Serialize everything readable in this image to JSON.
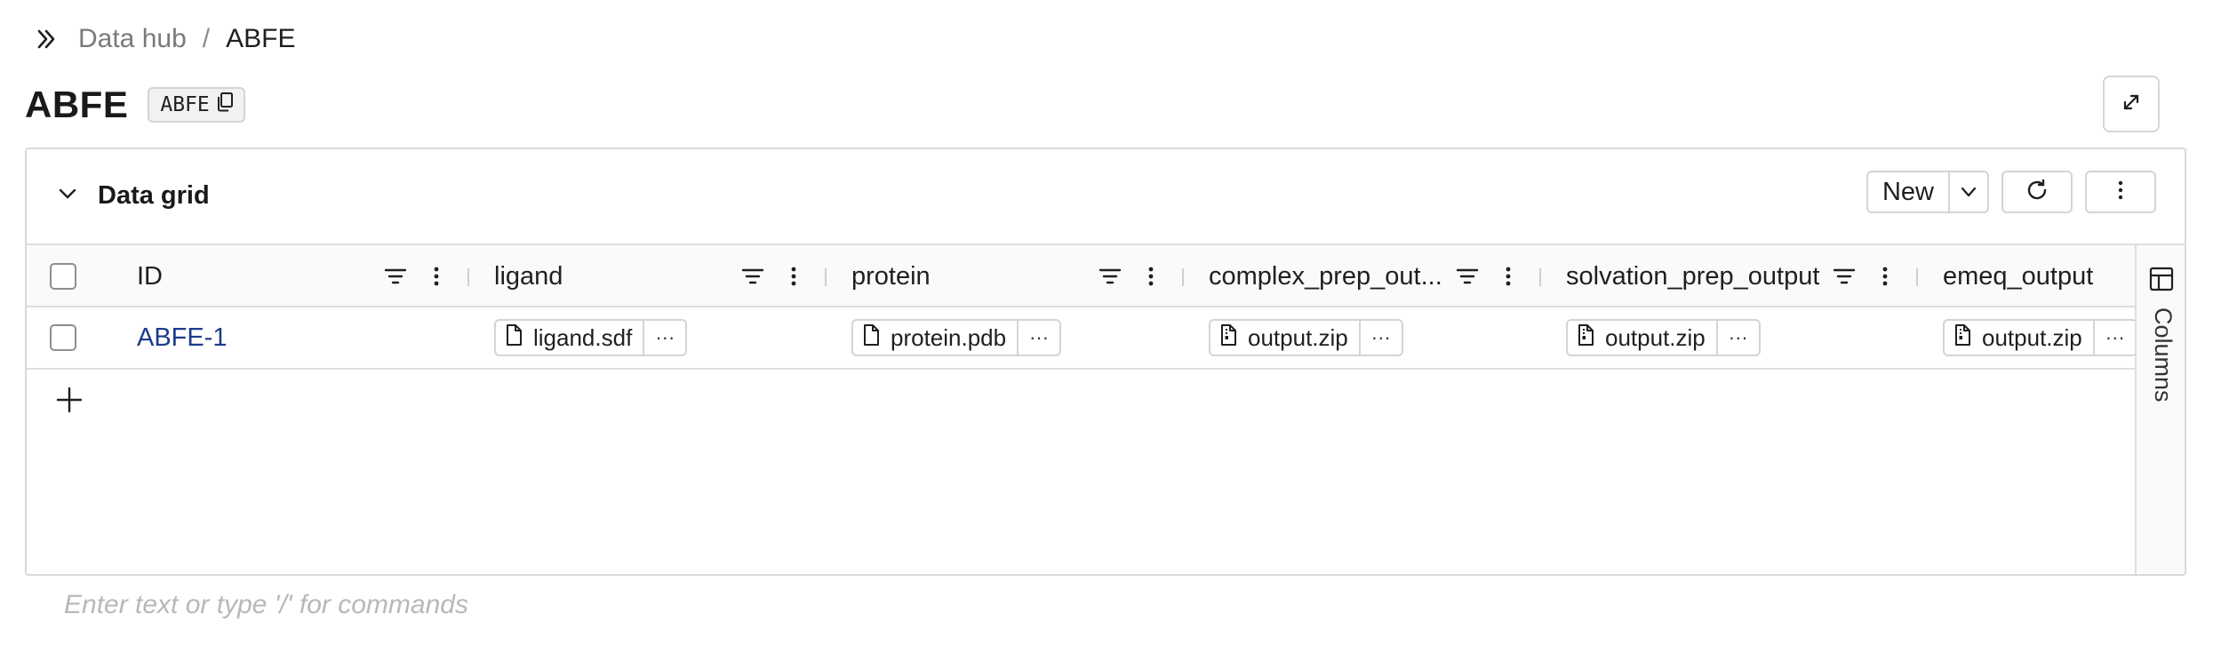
{
  "breadcrumb": {
    "parent": "Data hub",
    "separator": "/",
    "current": "ABFE",
    "toggle_icon": "double-chevron-right-icon"
  },
  "header": {
    "title": "ABFE",
    "tag": "ABFE",
    "tag_icon": "copy-icon",
    "expand_icon": "expand-icon"
  },
  "panel": {
    "title": "Data grid",
    "collapse_icon": "chevron-down-icon",
    "toolbar": {
      "new_label": "New",
      "new_menu_icon": "chevron-down-icon",
      "refresh_icon": "refresh-icon",
      "more_icon": "vertical-dots-icon"
    }
  },
  "grid": {
    "columns": [
      {
        "key": "id",
        "label": "ID"
      },
      {
        "key": "ligand",
        "label": "ligand"
      },
      {
        "key": "protein",
        "label": "protein"
      },
      {
        "key": "complex",
        "label": "complex_prep_out..."
      },
      {
        "key": "solvation",
        "label": "solvation_prep_output"
      },
      {
        "key": "emeq",
        "label": "emeq_output"
      }
    ],
    "rows": [
      {
        "id": "ABFE-1",
        "ligand": {
          "file": "ligand.sdf",
          "icon": "file-icon",
          "more": "···"
        },
        "protein": {
          "file": "protein.pdb",
          "icon": "file-icon",
          "more": "···"
        },
        "complex": {
          "file": "output.zip",
          "icon": "zip-file-icon",
          "more": "···"
        },
        "solvation": {
          "file": "output.zip",
          "icon": "zip-file-icon",
          "more": "···"
        },
        "emeq": {
          "file": "output.zip",
          "icon": "zip-file-icon",
          "more": "···"
        }
      }
    ],
    "add_row_icon": "plus-icon",
    "side_panel": {
      "label": "Columns",
      "icon": "columns-icon"
    }
  },
  "editor": {
    "placeholder": "Enter text or type '/' for commands"
  }
}
